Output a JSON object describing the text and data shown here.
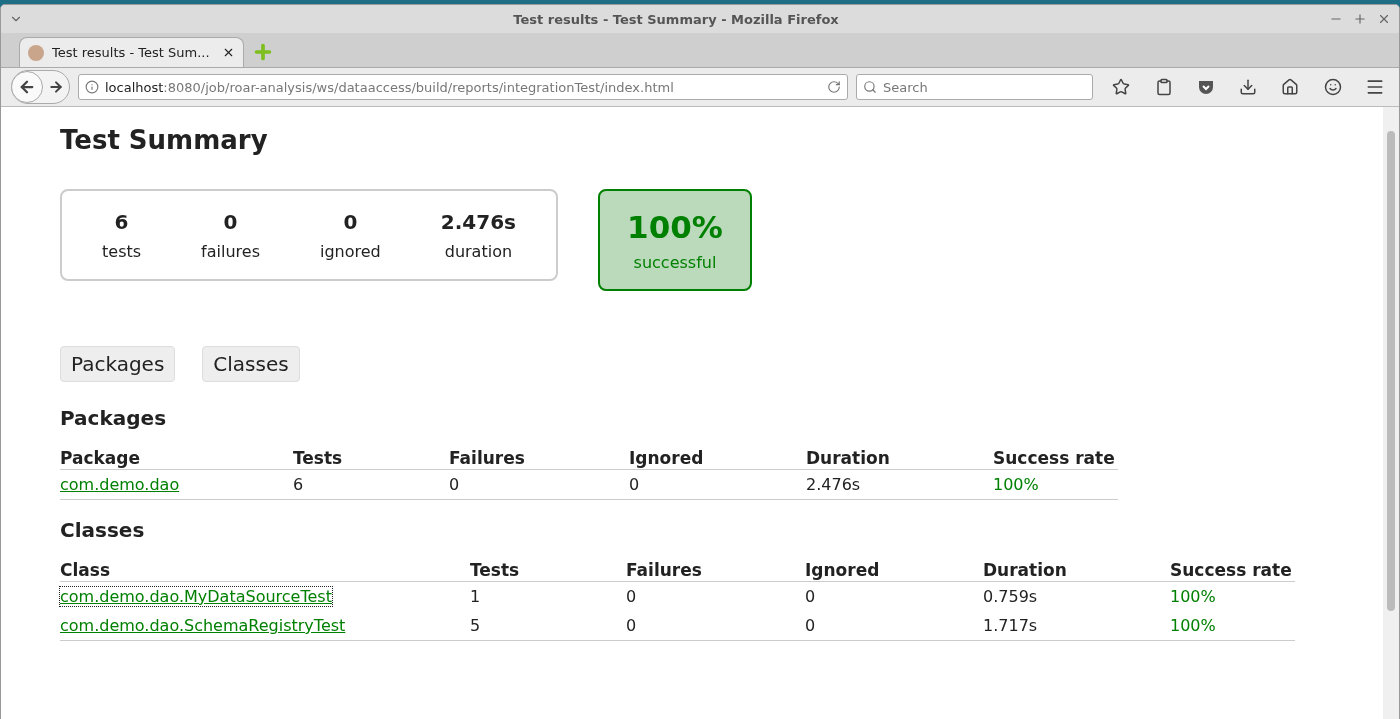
{
  "window": {
    "title": "Test results - Test Summary - Mozilla Firefox"
  },
  "tabs": [
    {
      "label": "Test results - Test Sum...",
      "selected": true
    }
  ],
  "address_bar": {
    "host": "localhost",
    "path": ":8080/job/roar-analysis/ws/dataaccess/build/reports/integrationTest/index.html"
  },
  "search": {
    "placeholder": "Search"
  },
  "page": {
    "title": "Test Summary",
    "counters": [
      {
        "value": "6",
        "label": "tests"
      },
      {
        "value": "0",
        "label": "failures"
      },
      {
        "value": "0",
        "label": "ignored"
      },
      {
        "value": "2.476s",
        "label": "duration"
      }
    ],
    "success_rate": {
      "value": "100%",
      "label": "successful",
      "passed": true
    },
    "tab_links": [
      "Packages",
      "Classes"
    ],
    "packages": {
      "heading": "Packages",
      "columns": [
        "Package",
        "Tests",
        "Failures",
        "Ignored",
        "Duration",
        "Success rate"
      ],
      "rows": [
        {
          "cells": [
            "com.demo.dao",
            "6",
            "0",
            "0",
            "2.476s",
            "100%"
          ],
          "focused": false
        }
      ]
    },
    "classes": {
      "heading": "Classes",
      "columns": [
        "Class",
        "Tests",
        "Failures",
        "Ignored",
        "Duration",
        "Success rate"
      ],
      "rows": [
        {
          "cells": [
            "com.demo.dao.MyDataSourceTest",
            "1",
            "0",
            "0",
            "0.759s",
            "100%"
          ],
          "focused": true
        },
        {
          "cells": [
            "com.demo.dao.SchemaRegistryTest",
            "5",
            "0",
            "0",
            "1.717s",
            "100%"
          ],
          "focused": false
        }
      ]
    }
  }
}
